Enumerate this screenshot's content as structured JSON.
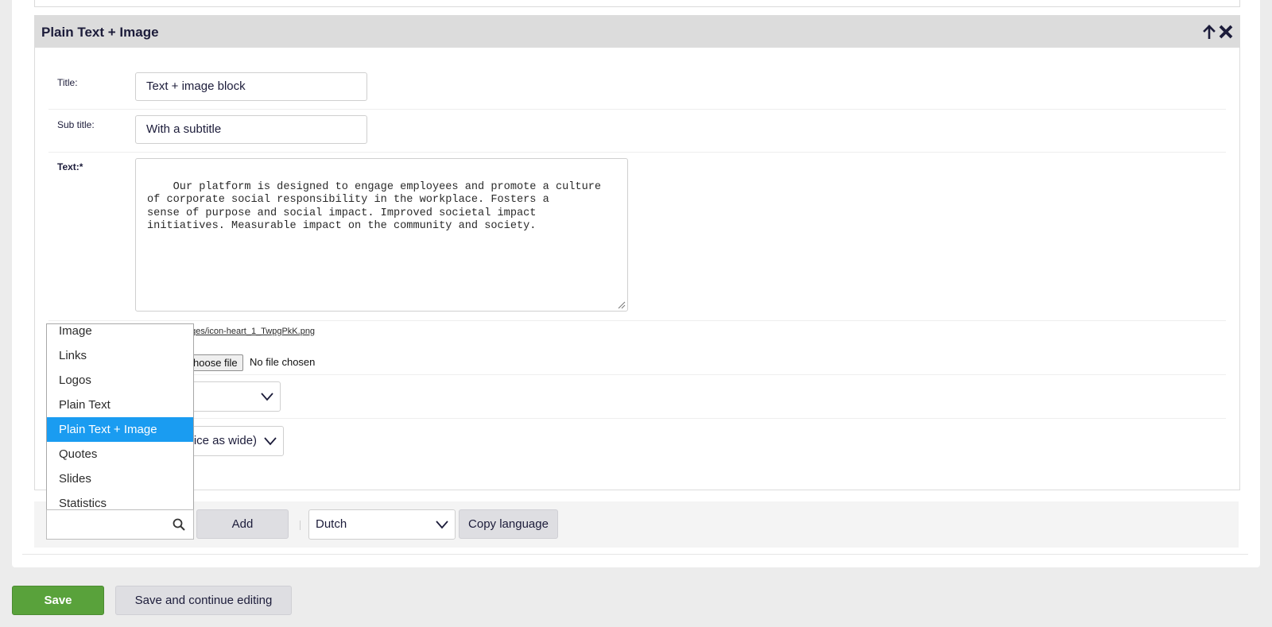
{
  "block": {
    "title": "Plain Text + Image",
    "icons": {
      "move_up": "arrow-up-icon",
      "delete": "close-x-icon"
    }
  },
  "fields": {
    "title": {
      "label": "Title:",
      "value": "Text + image block"
    },
    "subtitle": {
      "label": "Sub title:",
      "value": "With a subtitle"
    },
    "text": {
      "label": "Text:*",
      "value": "Our platform is designed to engage employees and promote a culture\nof corporate social responsibility in the workplace. Fosters a\nsense of purpose and social impact. Improved societal impact\ninitiatives. Measurable impact on the community and society."
    },
    "image": {
      "current_path": "ages/icon-heart_1_TwpgPkK.png",
      "choose_label": "hoose file",
      "status": "No file chosen"
    },
    "select_one": {
      "value": ""
    },
    "select_two": {
      "value": "wice as wide)"
    }
  },
  "block_type_dropdown": {
    "items": [
      "Image",
      "Links",
      "Logos",
      "Plain Text",
      "Plain Text + Image",
      "Quotes",
      "Slides",
      "Statistics"
    ],
    "selected": "Plain Text + Image",
    "search_placeholder": "",
    "search_icon": "magnifier-icon"
  },
  "toolbar": {
    "add_label": "Add",
    "language": "Dutch",
    "copy_language_label": "Copy language"
  },
  "footer": {
    "save_label": "Save",
    "save_continue_label": "Save and continue editing"
  },
  "colors": {
    "primary_text": "#1c1c3a",
    "header_bg": "#dcdcdc",
    "save_green": "#59a23b",
    "selection_blue": "#1a9cf1"
  }
}
